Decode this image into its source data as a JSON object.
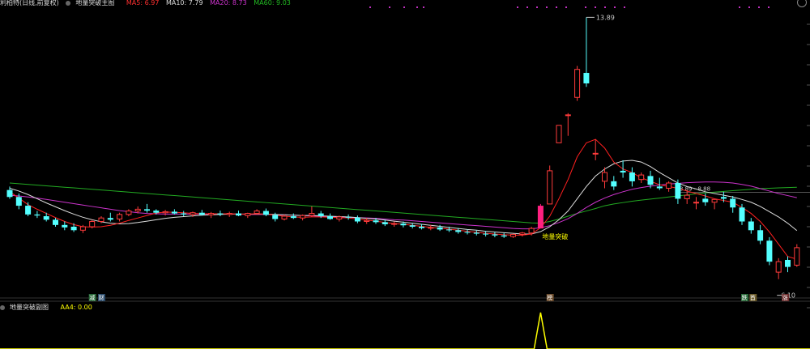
{
  "main_header": {
    "stock": "利柏特(日线,前复权)",
    "indicator": "地量突破主图",
    "ma5": "MA5: 6.97",
    "ma10": "MA10: 7.79",
    "ma20": "MA20: 8.73",
    "ma60": "MA60: 9.03"
  },
  "sub_header": {
    "indicator": "地量突破副图",
    "aa4": "AA4: 0.00"
  },
  "colors": {
    "up": "#ff3b3b",
    "down": "#54ffff",
    "ma5": "#ff2020",
    "ma10": "#dddddd",
    "ma20": "#cc33cc",
    "ma60": "#22aa22",
    "signal": "#ff2080",
    "sub": "#ffff00"
  },
  "chart_data": {
    "type": "candlestick",
    "annotations": {
      "high": "13.89",
      "low": "6.10",
      "signal_label": "地量突破",
      "level_label": "8.89 - 8.88"
    },
    "markers": [
      "减",
      "财",
      "榜",
      "跌",
      "首",
      "涨"
    ],
    "candles": [
      [
        8.95,
        9.05,
        8.7,
        8.75
      ],
      [
        8.75,
        8.85,
        8.4,
        8.5
      ],
      [
        8.5,
        8.6,
        8.2,
        8.25
      ],
      [
        8.25,
        8.35,
        8.15,
        8.22
      ],
      [
        8.2,
        8.3,
        8.05,
        8.1
      ],
      [
        8.1,
        8.15,
        7.9,
        7.95
      ],
      [
        7.95,
        8.05,
        7.8,
        7.88
      ],
      [
        7.9,
        8.0,
        7.75,
        7.8
      ],
      [
        7.8,
        7.95,
        7.72,
        7.9
      ],
      [
        7.9,
        8.1,
        7.85,
        8.05
      ],
      [
        8.05,
        8.2,
        8.0,
        8.15
      ],
      [
        8.15,
        8.3,
        8.05,
        8.1
      ],
      [
        8.12,
        8.3,
        8.05,
        8.25
      ],
      [
        8.25,
        8.4,
        8.2,
        8.35
      ],
      [
        8.35,
        8.48,
        8.28,
        8.4
      ],
      [
        8.4,
        8.55,
        8.3,
        8.36
      ],
      [
        8.36,
        8.4,
        8.25,
        8.3
      ],
      [
        8.3,
        8.38,
        8.22,
        8.33
      ],
      [
        8.33,
        8.4,
        8.25,
        8.28
      ],
      [
        8.28,
        8.35,
        8.2,
        8.25
      ],
      [
        8.25,
        8.33,
        8.18,
        8.3
      ],
      [
        8.3,
        8.38,
        8.22,
        8.24
      ],
      [
        8.24,
        8.32,
        8.15,
        8.28
      ],
      [
        8.28,
        8.36,
        8.2,
        8.25
      ],
      [
        8.25,
        8.33,
        8.18,
        8.28
      ],
      [
        8.28,
        8.36,
        8.2,
        8.22
      ],
      [
        8.22,
        8.3,
        8.15,
        8.28
      ],
      [
        8.28,
        8.4,
        8.25,
        8.35
      ],
      [
        8.35,
        8.42,
        8.2,
        8.24
      ],
      [
        8.24,
        8.3,
        8.05,
        8.12
      ],
      [
        8.12,
        8.25,
        8.08,
        8.2
      ],
      [
        8.2,
        8.28,
        8.12,
        8.15
      ],
      [
        8.15,
        8.25,
        8.08,
        8.22
      ],
      [
        8.22,
        8.48,
        8.18,
        8.28
      ],
      [
        8.28,
        8.35,
        8.15,
        8.2
      ],
      [
        8.2,
        8.28,
        8.1,
        8.12
      ],
      [
        8.12,
        8.22,
        8.05,
        8.18
      ],
      [
        8.18,
        8.25,
        8.1,
        8.16
      ],
      [
        8.16,
        8.22,
        8.0,
        8.05
      ],
      [
        8.05,
        8.15,
        7.98,
        8.08
      ],
      [
        8.08,
        8.15,
        7.98,
        8.03
      ],
      [
        8.03,
        8.1,
        7.92,
        7.97
      ],
      [
        7.97,
        8.05,
        7.9,
        7.99
      ],
      [
        7.99,
        8.05,
        7.88,
        7.94
      ],
      [
        7.94,
        8.0,
        7.85,
        7.9
      ],
      [
        7.9,
        7.98,
        7.82,
        7.86
      ],
      [
        7.86,
        7.95,
        7.8,
        7.88
      ],
      [
        7.88,
        7.95,
        7.78,
        7.82
      ],
      [
        7.82,
        7.9,
        7.75,
        7.8
      ],
      [
        7.8,
        7.86,
        7.7,
        7.75
      ],
      [
        7.75,
        7.82,
        7.68,
        7.73
      ],
      [
        7.73,
        7.8,
        7.65,
        7.7
      ],
      [
        7.7,
        7.78,
        7.62,
        7.68
      ],
      [
        7.68,
        7.75,
        7.6,
        7.65
      ],
      [
        7.65,
        7.72,
        7.58,
        7.62
      ],
      [
        7.62,
        7.7,
        7.58,
        7.68
      ],
      [
        7.68,
        7.75,
        7.62,
        7.72
      ],
      [
        7.72,
        7.9,
        7.65,
        7.85
      ],
      [
        7.85,
        8.55,
        7.85,
        8.5
      ],
      [
        8.55,
        9.65,
        8.55,
        9.5
      ],
      [
        10.3,
        10.8,
        10.3,
        10.8
      ],
      [
        11.1,
        11.15,
        10.5,
        11.1
      ],
      [
        11.6,
        12.5,
        11.5,
        12.4
      ],
      [
        12.3,
        13.89,
        11.9,
        12.0
      ],
      [
        10.0,
        10.4,
        9.8,
        10.0
      ],
      [
        9.2,
        9.6,
        9.0,
        9.45
      ],
      [
        9.2,
        9.35,
        8.95,
        9.05
      ],
      [
        9.5,
        9.8,
        9.3,
        9.45
      ],
      [
        9.45,
        9.6,
        9.05,
        9.2
      ],
      [
        9.25,
        9.45,
        9.15,
        9.38
      ],
      [
        9.35,
        9.5,
        9.0,
        9.1
      ],
      [
        9.05,
        9.3,
        8.95,
        9.0
      ],
      [
        9.0,
        9.2,
        8.9,
        9.15
      ],
      [
        9.15,
        9.25,
        8.55,
        8.7
      ],
      [
        8.7,
        8.95,
        8.55,
        8.8
      ],
      [
        8.6,
        8.75,
        8.4,
        8.6
      ],
      [
        8.7,
        8.85,
        8.5,
        8.6
      ],
      [
        8.6,
        8.7,
        8.4,
        8.68
      ],
      [
        8.75,
        8.9,
        8.6,
        8.7
      ],
      [
        8.7,
        8.78,
        8.3,
        8.45
      ],
      [
        8.45,
        8.55,
        7.95,
        8.05
      ],
      [
        8.05,
        8.15,
        7.7,
        7.8
      ],
      [
        7.8,
        7.95,
        7.4,
        7.5
      ],
      [
        7.5,
        7.6,
        6.8,
        6.9
      ],
      [
        6.6,
        7.0,
        6.4,
        6.9
      ],
      [
        6.95,
        7.05,
        6.6,
        6.75
      ],
      [
        6.8,
        7.4,
        6.75,
        7.3
      ]
    ],
    "ma5": [
      8.9,
      8.72,
      8.53,
      8.4,
      8.28,
      8.16,
      8.05,
      7.96,
      7.9,
      7.89,
      7.9,
      7.94,
      8.0,
      8.08,
      8.15,
      8.22,
      8.29,
      8.32,
      8.31,
      8.3,
      8.28,
      8.27,
      8.27,
      8.27,
      8.27,
      8.26,
      8.26,
      8.27,
      8.26,
      8.23,
      8.2,
      8.18,
      8.17,
      8.18,
      8.18,
      8.17,
      8.16,
      8.15,
      8.12,
      8.09,
      8.06,
      8.02,
      7.99,
      7.97,
      7.94,
      7.91,
      7.88,
      7.86,
      7.83,
      7.8,
      7.77,
      7.74,
      7.71,
      7.69,
      7.67,
      7.66,
      7.66,
      7.69,
      7.87,
      8.2,
      8.7,
      9.25,
      9.9,
      10.3,
      10.4,
      10.15,
      9.75,
      9.55,
      9.45,
      9.3,
      9.2,
      9.1,
      9.05,
      9.0,
      8.92,
      8.85,
      8.78,
      8.7,
      8.65,
      8.6,
      8.45,
      8.28,
      8.05,
      7.75,
      7.4,
      7.05,
      6.97
    ],
    "ma10": [
      9.0,
      8.92,
      8.82,
      8.7,
      8.58,
      8.47,
      8.36,
      8.26,
      8.17,
      8.1,
      8.04,
      8.0,
      7.98,
      7.99,
      8.02,
      8.06,
      8.1,
      8.14,
      8.17,
      8.19,
      8.21,
      8.23,
      8.24,
      8.25,
      8.26,
      8.26,
      8.26,
      8.26,
      8.26,
      8.25,
      8.24,
      8.23,
      8.22,
      8.22,
      8.21,
      8.2,
      8.19,
      8.18,
      8.16,
      8.14,
      8.12,
      8.09,
      8.06,
      8.03,
      8.0,
      7.97,
      7.94,
      7.91,
      7.88,
      7.85,
      7.82,
      7.8,
      7.77,
      7.75,
      7.73,
      7.71,
      7.69,
      7.69,
      7.76,
      7.9,
      8.1,
      8.35,
      8.7,
      9.05,
      9.35,
      9.55,
      9.7,
      9.78,
      9.8,
      9.75,
      9.62,
      9.45,
      9.3,
      9.15,
      9.05,
      8.98,
      8.9,
      8.85,
      8.8,
      8.75,
      8.68,
      8.6,
      8.48,
      8.33,
      8.18,
      8.0,
      7.79
    ],
    "ma20": [
      8.8,
      8.78,
      8.75,
      8.72,
      8.68,
      8.64,
      8.6,
      8.56,
      8.52,
      8.48,
      8.44,
      8.4,
      8.36,
      8.33,
      8.3,
      8.28,
      8.27,
      8.26,
      8.26,
      8.26,
      8.26,
      8.26,
      8.26,
      8.26,
      8.26,
      8.26,
      8.25,
      8.25,
      8.25,
      8.24,
      8.24,
      8.23,
      8.22,
      8.21,
      8.2,
      8.19,
      8.18,
      8.17,
      8.16,
      8.15,
      8.14,
      8.12,
      8.1,
      8.09,
      8.07,
      8.05,
      8.03,
      8.01,
      7.99,
      7.97,
      7.95,
      7.93,
      7.91,
      7.89,
      7.87,
      7.85,
      7.84,
      7.84,
      7.87,
      7.93,
      8.02,
      8.13,
      8.28,
      8.45,
      8.6,
      8.72,
      8.82,
      8.9,
      8.97,
      9.02,
      9.06,
      9.09,
      9.12,
      9.14,
      9.16,
      9.17,
      9.18,
      9.18,
      9.17,
      9.15,
      9.11,
      9.06,
      8.99,
      8.92,
      8.85,
      8.79,
      8.73
    ],
    "ma60": [
      9.15,
      9.13,
      9.11,
      9.09,
      9.07,
      9.05,
      9.03,
      9.01,
      8.99,
      8.97,
      8.95,
      8.93,
      8.91,
      8.89,
      8.87,
      8.85,
      8.83,
      8.81,
      8.79,
      8.77,
      8.75,
      8.73,
      8.71,
      8.69,
      8.67,
      8.65,
      8.63,
      8.61,
      8.59,
      8.57,
      8.55,
      8.53,
      8.51,
      8.49,
      8.47,
      8.45,
      8.43,
      8.41,
      8.39,
      8.37,
      8.35,
      8.33,
      8.31,
      8.29,
      8.27,
      8.25,
      8.23,
      8.21,
      8.19,
      8.17,
      8.15,
      8.13,
      8.11,
      8.09,
      8.07,
      8.05,
      8.03,
      8.01,
      8.0,
      8.05,
      8.12,
      8.2,
      8.28,
      8.35,
      8.42,
      8.5,
      8.55,
      8.59,
      8.63,
      8.66,
      8.69,
      8.72,
      8.75,
      8.78,
      8.81,
      8.84,
      8.87,
      8.89,
      8.91,
      8.93,
      8.95,
      8.97,
      8.99,
      9.0,
      9.01,
      9.02,
      9.03
    ],
    "signal_index": 58,
    "sub_peak_index": 58
  }
}
